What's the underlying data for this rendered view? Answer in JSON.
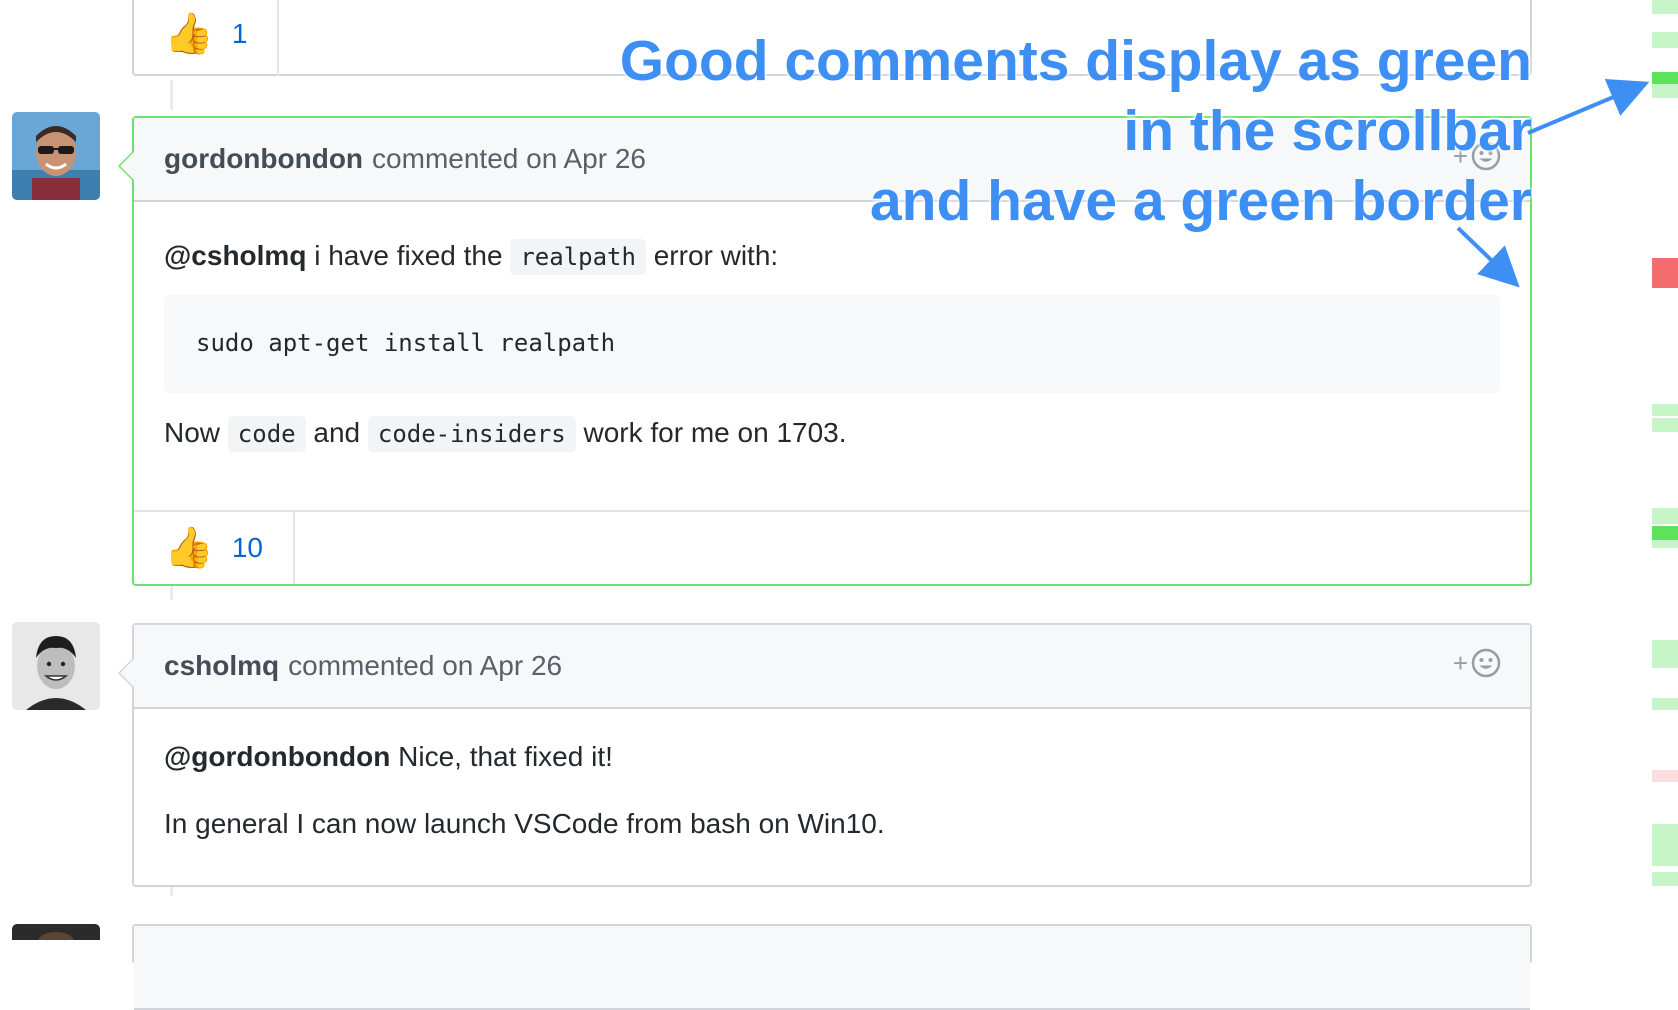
{
  "comments": [
    {
      "reaction": {
        "emoji": "👍",
        "count": "1"
      }
    },
    {
      "author": "gordonbondon",
      "meta": "commented on Apr 26",
      "mention": "@csholmq",
      "line1_mid": "i have fixed the",
      "line1_code": "realpath",
      "line1_end": "error with:",
      "code_block": "sudo apt-get install realpath",
      "line2_start": "Now",
      "line2_code1": "code",
      "line2_and": "and",
      "line2_code2": "code-insiders",
      "line2_end": "work for me on 1703.",
      "reaction": {
        "emoji": "👍",
        "count": "10"
      },
      "highlight": "green"
    },
    {
      "author": "csholmq",
      "meta": "commented on Apr 26",
      "mention": "@gordonbondon",
      "line1_rest": "Nice, that fixed it!",
      "line2": "In general I can now launch VSCode from bash on Win10."
    }
  ],
  "annotation": {
    "line1": "Good comments display as green",
    "line2": "in the scrollbar",
    "line3": "and have a green border",
    "color": "#3e8ff3"
  },
  "add_reaction_icon": "smiley-plus-icon",
  "colors": {
    "good_border": "#6ce26c",
    "scroll_good": "#c8f5c8",
    "scroll_best": "#5be35b",
    "scroll_bad": "#f56c6c",
    "scroll_bad_light": "#fcdcdc",
    "link": "#0366d6"
  }
}
